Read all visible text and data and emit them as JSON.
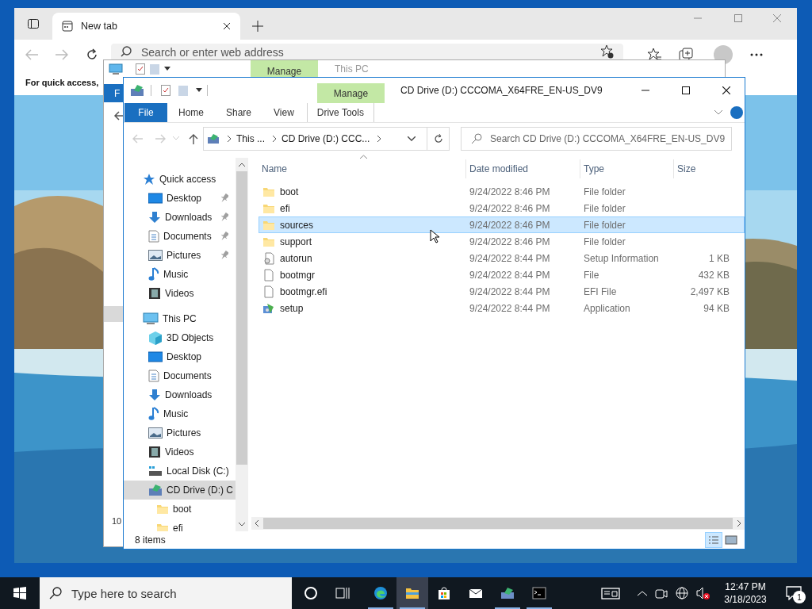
{
  "browser": {
    "tabs": [
      {
        "label": "New tab",
        "selected": true
      }
    ],
    "address": {
      "placeholder": "Search or enter web address"
    },
    "page_text": "For quick access,"
  },
  "back_window": {
    "context_tab": "Manage",
    "title": "This PC",
    "file_tab": "F",
    "status_text": "10"
  },
  "explorer": {
    "title": "CD Drive (D:) CCCOMA_X64FRE_EN-US_DV9",
    "context_tab": "Manage",
    "ribbon_tabs": [
      {
        "label": "File",
        "kind": "file"
      },
      {
        "label": "Home",
        "kind": "tab"
      },
      {
        "label": "Share",
        "kind": "tab"
      },
      {
        "label": "View",
        "kind": "tab"
      },
      {
        "label": "Drive Tools",
        "kind": "context"
      }
    ],
    "breadcrumbs": [
      "This ...",
      "CD Drive (D:) CCC..."
    ],
    "search": {
      "placeholder": "Search CD Drive (D:) CCCOMA_X64FRE_EN-US_DV9"
    },
    "nav": [
      {
        "label": "Quick access",
        "kind": "star",
        "selected": false,
        "children": [
          {
            "label": "Desktop",
            "kind": "desktop",
            "pinned": true,
            "selected": false
          },
          {
            "label": "Downloads",
            "kind": "download",
            "pinned": true,
            "selected": false
          },
          {
            "label": "Documents",
            "kind": "document",
            "pinned": true,
            "selected": false
          },
          {
            "label": "Pictures",
            "kind": "picture",
            "pinned": true,
            "selected": false
          },
          {
            "label": "Music",
            "kind": "music",
            "pinned": false,
            "selected": false
          },
          {
            "label": "Videos",
            "kind": "video",
            "pinned": false,
            "selected": false
          }
        ]
      },
      {
        "label": "This PC",
        "kind": "computer",
        "selected": false,
        "children": [
          {
            "label": "3D Objects",
            "kind": "cube",
            "selected": false
          },
          {
            "label": "Desktop",
            "kind": "desktop",
            "selected": false
          },
          {
            "label": "Documents",
            "kind": "document",
            "selected": false
          },
          {
            "label": "Downloads",
            "kind": "download",
            "selected": false
          },
          {
            "label": "Music",
            "kind": "music",
            "selected": false
          },
          {
            "label": "Pictures",
            "kind": "picture",
            "selected": false
          },
          {
            "label": "Videos",
            "kind": "video",
            "selected": false
          },
          {
            "label": "Local Disk (C:)",
            "kind": "disk",
            "selected": false
          },
          {
            "label": "CD Drive (D:) C",
            "kind": "cd",
            "selected": true,
            "children": [
              {
                "label": "boot",
                "kind": "folder",
                "selected": false
              },
              {
                "label": "efi",
                "kind": "folder",
                "selected": false
              }
            ]
          }
        ]
      }
    ],
    "columns": [
      "Name",
      "Date modified",
      "Type",
      "Size"
    ],
    "rows": [
      {
        "name": "boot",
        "date": "9/24/2022 8:46 PM",
        "type": "File folder",
        "kind": "folder",
        "selected": false
      },
      {
        "name": "efi",
        "date": "9/24/2022 8:46 PM",
        "type": "File folder",
        "kind": "folder",
        "selected": false
      },
      {
        "name": "sources",
        "date": "9/24/2022 8:46 PM",
        "type": "File folder",
        "kind": "folder",
        "selected": true
      },
      {
        "name": "support",
        "date": "9/24/2022 8:46 PM",
        "type": "File folder",
        "kind": "folder",
        "selected": false
      },
      {
        "name": "autorun",
        "date": "9/24/2022 8:44 PM",
        "type": "Setup Information",
        "size": "1 KB",
        "kind": "config",
        "selected": false
      },
      {
        "name": "bootmgr",
        "date": "9/24/2022 8:44 PM",
        "type": "File",
        "size": "432 KB",
        "kind": "file",
        "selected": false
      },
      {
        "name": "bootmgr.efi",
        "date": "9/24/2022 8:44 PM",
        "type": "EFI File",
        "size": "2,497 KB",
        "kind": "file",
        "selected": false
      },
      {
        "name": "setup",
        "date": "9/24/2022 8:44 PM",
        "type": "Application",
        "size": "94 KB",
        "kind": "setup",
        "selected": false
      }
    ],
    "status": "8 items",
    "views": [
      {
        "kind": "details",
        "selected": true
      },
      {
        "kind": "tiles",
        "selected": false
      }
    ]
  },
  "taskbar": {
    "search": {
      "placeholder": "Type here to search"
    },
    "apps": [
      {
        "kind": "cortana",
        "running": false,
        "selected": false
      },
      {
        "kind": "taskview",
        "running": false,
        "selected": false
      },
      {
        "kind": "edge",
        "running": true,
        "selected": false
      },
      {
        "kind": "explorer",
        "running": true,
        "selected": true
      },
      {
        "kind": "store",
        "running": false,
        "selected": false
      },
      {
        "kind": "mail",
        "running": false,
        "selected": false
      },
      {
        "kind": "cdexplorer",
        "running": true,
        "selected": false
      },
      {
        "kind": "terminal",
        "running": true,
        "selected": false
      }
    ],
    "time": "12:47 PM",
    "date": "3/18/2023",
    "notifications": "1"
  }
}
